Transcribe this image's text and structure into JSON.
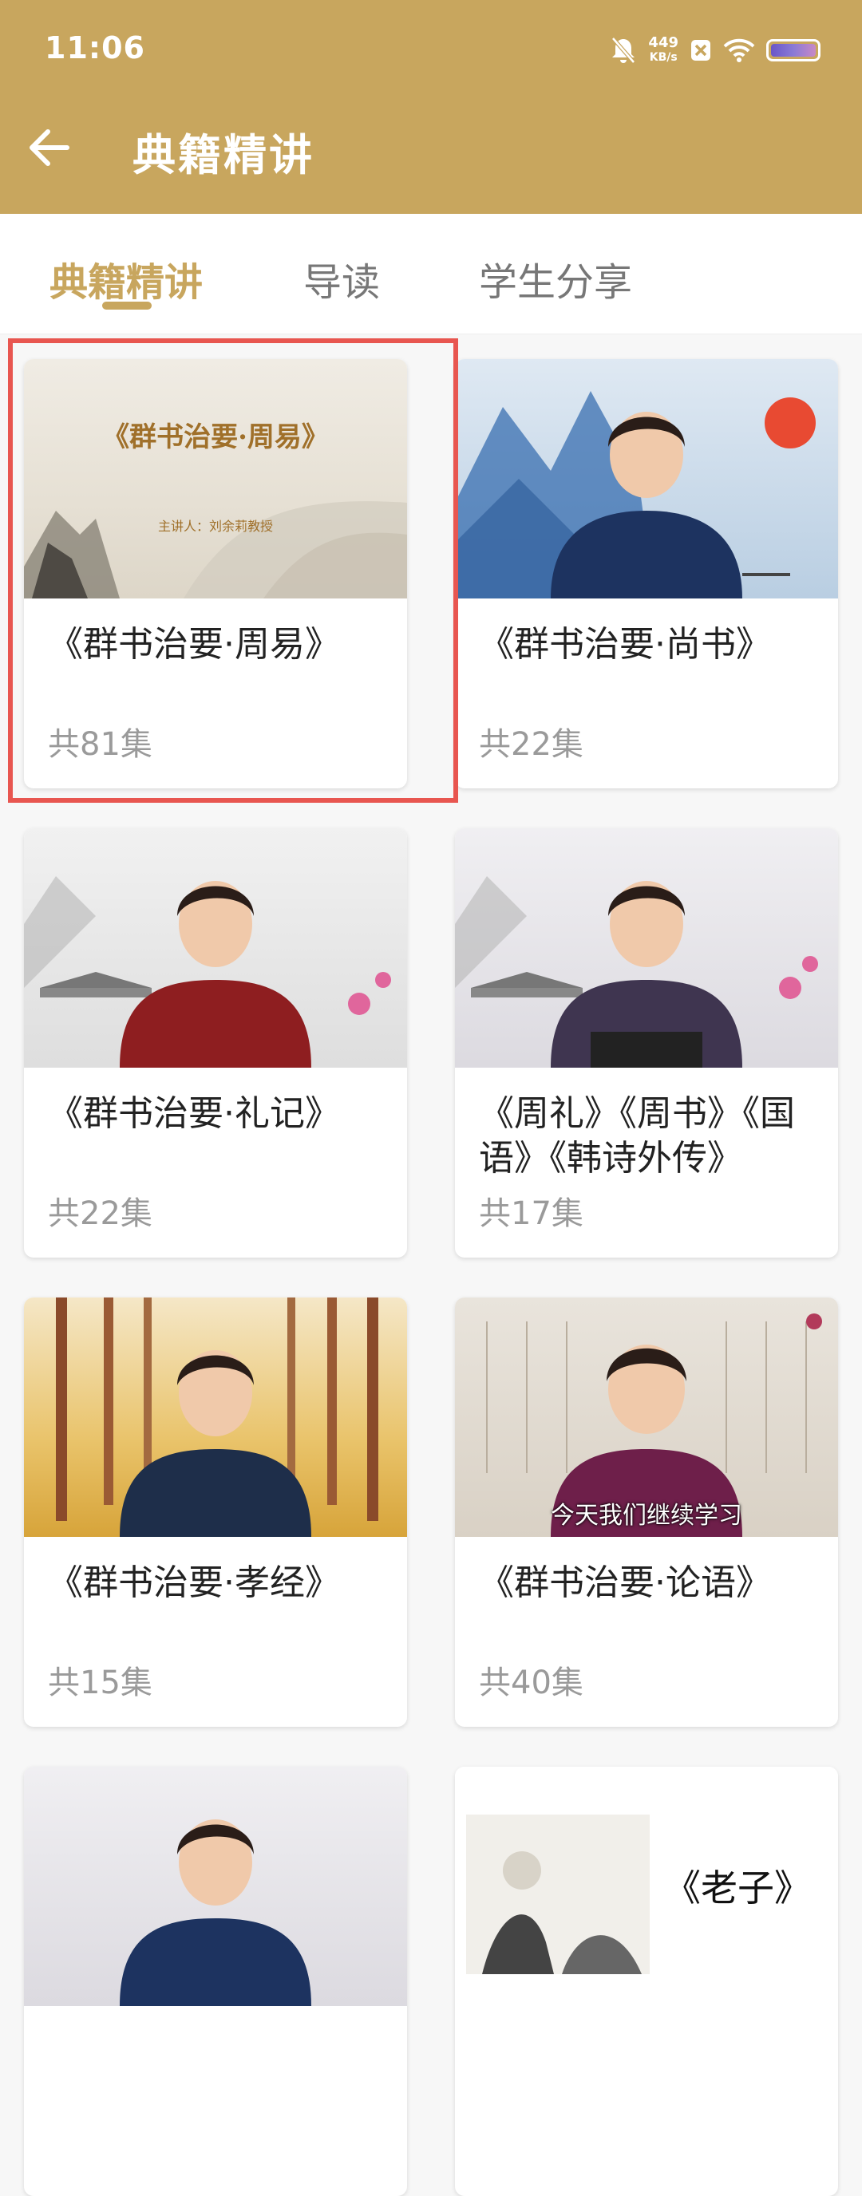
{
  "status_bar": {
    "time": "11:06",
    "net_speed_value": "449",
    "net_speed_unit": "KB/s"
  },
  "header": {
    "title": "典籍精讲"
  },
  "tabs": [
    {
      "label": "典籍精讲",
      "active": true
    },
    {
      "label": "导读",
      "active": false
    },
    {
      "label": "学生分享",
      "active": false
    }
  ],
  "cards": [
    {
      "title": "《群书治要·周易》",
      "count": "共81集",
      "thumb_title": "《群书治要·周易》",
      "thumb_subtitle": "主讲人：刘余莉教授"
    },
    {
      "title": "《群书治要·尚书》",
      "count": "共22集"
    },
    {
      "title": "《群书治要·礼记》",
      "count": "共22集"
    },
    {
      "title": "《周礼》《周书》《国语》《韩诗外传》",
      "count": "共17集"
    },
    {
      "title": "《群书治要·孝经》",
      "count": "共15集"
    },
    {
      "title": "《群书治要·论语》",
      "count": "共40集",
      "thumb_caption": "今天我们继续学习"
    },
    {
      "title": "",
      "count": ""
    },
    {
      "title": "《老子》",
      "count": ""
    }
  ],
  "colors": {
    "accent": "#c8a65e",
    "highlight": "#e85650"
  }
}
